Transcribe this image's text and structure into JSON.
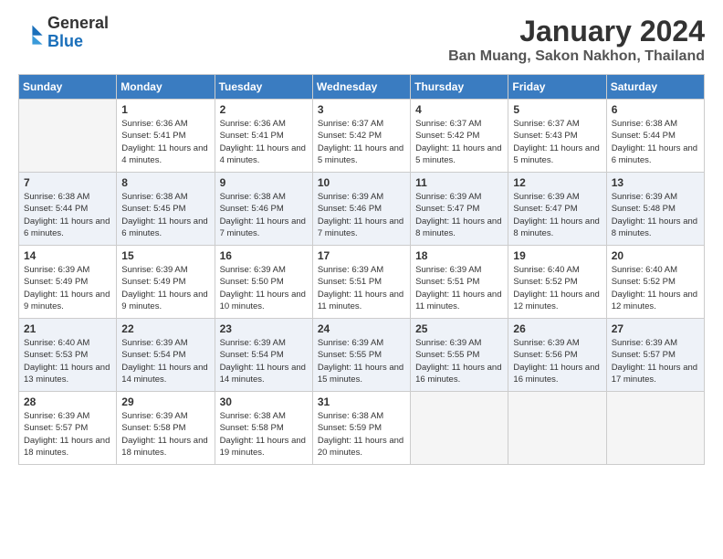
{
  "logo": {
    "text_general": "General",
    "text_blue": "Blue"
  },
  "title": "January 2024",
  "location": "Ban Muang, Sakon Nakhon, Thailand",
  "days_of_week": [
    "Sunday",
    "Monday",
    "Tuesday",
    "Wednesday",
    "Thursday",
    "Friday",
    "Saturday"
  ],
  "weeks": [
    [
      {
        "num": "",
        "empty": true
      },
      {
        "num": "1",
        "sunrise": "Sunrise: 6:36 AM",
        "sunset": "Sunset: 5:41 PM",
        "daylight": "Daylight: 11 hours and 4 minutes."
      },
      {
        "num": "2",
        "sunrise": "Sunrise: 6:36 AM",
        "sunset": "Sunset: 5:41 PM",
        "daylight": "Daylight: 11 hours and 4 minutes."
      },
      {
        "num": "3",
        "sunrise": "Sunrise: 6:37 AM",
        "sunset": "Sunset: 5:42 PM",
        "daylight": "Daylight: 11 hours and 5 minutes."
      },
      {
        "num": "4",
        "sunrise": "Sunrise: 6:37 AM",
        "sunset": "Sunset: 5:42 PM",
        "daylight": "Daylight: 11 hours and 5 minutes."
      },
      {
        "num": "5",
        "sunrise": "Sunrise: 6:37 AM",
        "sunset": "Sunset: 5:43 PM",
        "daylight": "Daylight: 11 hours and 5 minutes."
      },
      {
        "num": "6",
        "sunrise": "Sunrise: 6:38 AM",
        "sunset": "Sunset: 5:44 PM",
        "daylight": "Daylight: 11 hours and 6 minutes."
      }
    ],
    [
      {
        "num": "7",
        "sunrise": "Sunrise: 6:38 AM",
        "sunset": "Sunset: 5:44 PM",
        "daylight": "Daylight: 11 hours and 6 minutes."
      },
      {
        "num": "8",
        "sunrise": "Sunrise: 6:38 AM",
        "sunset": "Sunset: 5:45 PM",
        "daylight": "Daylight: 11 hours and 6 minutes."
      },
      {
        "num": "9",
        "sunrise": "Sunrise: 6:38 AM",
        "sunset": "Sunset: 5:46 PM",
        "daylight": "Daylight: 11 hours and 7 minutes."
      },
      {
        "num": "10",
        "sunrise": "Sunrise: 6:39 AM",
        "sunset": "Sunset: 5:46 PM",
        "daylight": "Daylight: 11 hours and 7 minutes."
      },
      {
        "num": "11",
        "sunrise": "Sunrise: 6:39 AM",
        "sunset": "Sunset: 5:47 PM",
        "daylight": "Daylight: 11 hours and 8 minutes."
      },
      {
        "num": "12",
        "sunrise": "Sunrise: 6:39 AM",
        "sunset": "Sunset: 5:47 PM",
        "daylight": "Daylight: 11 hours and 8 minutes."
      },
      {
        "num": "13",
        "sunrise": "Sunrise: 6:39 AM",
        "sunset": "Sunset: 5:48 PM",
        "daylight": "Daylight: 11 hours and 8 minutes."
      }
    ],
    [
      {
        "num": "14",
        "sunrise": "Sunrise: 6:39 AM",
        "sunset": "Sunset: 5:49 PM",
        "daylight": "Daylight: 11 hours and 9 minutes."
      },
      {
        "num": "15",
        "sunrise": "Sunrise: 6:39 AM",
        "sunset": "Sunset: 5:49 PM",
        "daylight": "Daylight: 11 hours and 9 minutes."
      },
      {
        "num": "16",
        "sunrise": "Sunrise: 6:39 AM",
        "sunset": "Sunset: 5:50 PM",
        "daylight": "Daylight: 11 hours and 10 minutes."
      },
      {
        "num": "17",
        "sunrise": "Sunrise: 6:39 AM",
        "sunset": "Sunset: 5:51 PM",
        "daylight": "Daylight: 11 hours and 11 minutes."
      },
      {
        "num": "18",
        "sunrise": "Sunrise: 6:39 AM",
        "sunset": "Sunset: 5:51 PM",
        "daylight": "Daylight: 11 hours and 11 minutes."
      },
      {
        "num": "19",
        "sunrise": "Sunrise: 6:40 AM",
        "sunset": "Sunset: 5:52 PM",
        "daylight": "Daylight: 11 hours and 12 minutes."
      },
      {
        "num": "20",
        "sunrise": "Sunrise: 6:40 AM",
        "sunset": "Sunset: 5:52 PM",
        "daylight": "Daylight: 11 hours and 12 minutes."
      }
    ],
    [
      {
        "num": "21",
        "sunrise": "Sunrise: 6:40 AM",
        "sunset": "Sunset: 5:53 PM",
        "daylight": "Daylight: 11 hours and 13 minutes."
      },
      {
        "num": "22",
        "sunrise": "Sunrise: 6:39 AM",
        "sunset": "Sunset: 5:54 PM",
        "daylight": "Daylight: 11 hours and 14 minutes."
      },
      {
        "num": "23",
        "sunrise": "Sunrise: 6:39 AM",
        "sunset": "Sunset: 5:54 PM",
        "daylight": "Daylight: 11 hours and 14 minutes."
      },
      {
        "num": "24",
        "sunrise": "Sunrise: 6:39 AM",
        "sunset": "Sunset: 5:55 PM",
        "daylight": "Daylight: 11 hours and 15 minutes."
      },
      {
        "num": "25",
        "sunrise": "Sunrise: 6:39 AM",
        "sunset": "Sunset: 5:55 PM",
        "daylight": "Daylight: 11 hours and 16 minutes."
      },
      {
        "num": "26",
        "sunrise": "Sunrise: 6:39 AM",
        "sunset": "Sunset: 5:56 PM",
        "daylight": "Daylight: 11 hours and 16 minutes."
      },
      {
        "num": "27",
        "sunrise": "Sunrise: 6:39 AM",
        "sunset": "Sunset: 5:57 PM",
        "daylight": "Daylight: 11 hours and 17 minutes."
      }
    ],
    [
      {
        "num": "28",
        "sunrise": "Sunrise: 6:39 AM",
        "sunset": "Sunset: 5:57 PM",
        "daylight": "Daylight: 11 hours and 18 minutes."
      },
      {
        "num": "29",
        "sunrise": "Sunrise: 6:39 AM",
        "sunset": "Sunset: 5:58 PM",
        "daylight": "Daylight: 11 hours and 18 minutes."
      },
      {
        "num": "30",
        "sunrise": "Sunrise: 6:38 AM",
        "sunset": "Sunset: 5:58 PM",
        "daylight": "Daylight: 11 hours and 19 minutes."
      },
      {
        "num": "31",
        "sunrise": "Sunrise: 6:38 AM",
        "sunset": "Sunset: 5:59 PM",
        "daylight": "Daylight: 11 hours and 20 minutes."
      },
      {
        "num": "",
        "empty": true
      },
      {
        "num": "",
        "empty": true
      },
      {
        "num": "",
        "empty": true
      }
    ]
  ]
}
